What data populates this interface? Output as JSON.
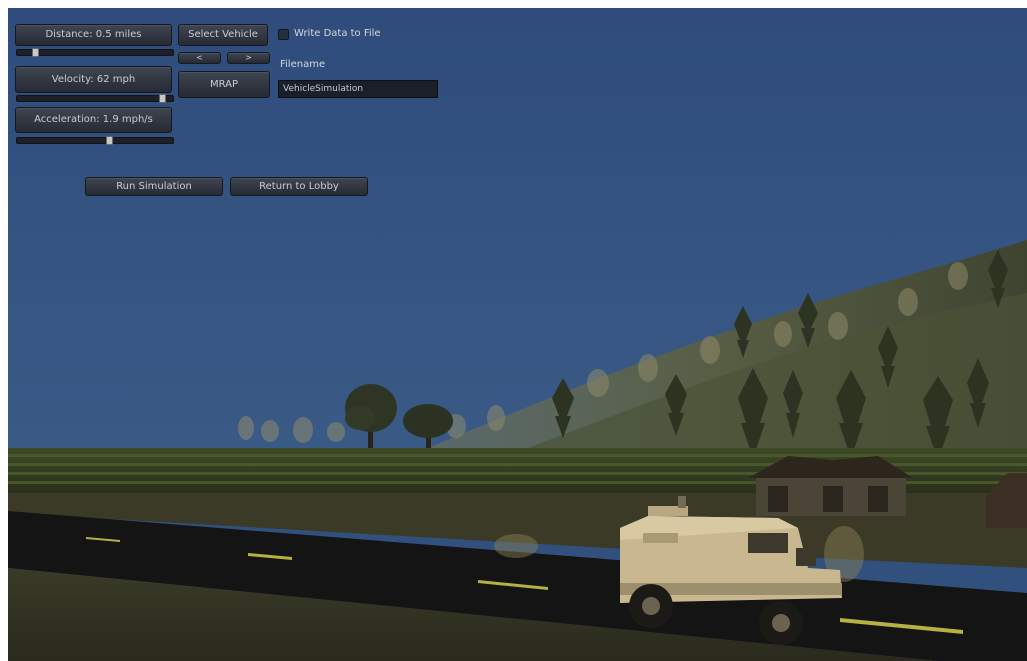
{
  "controls": {
    "distance_label": "Distance: 0.5 miles",
    "distance_slider_level": 0.1,
    "velocity_label": "Velocity: 62 mph",
    "velocity_slider_level": 0.95,
    "acceleration_label": "Acceleration: 1.9 mph/s",
    "acceleration_slider_level": 0.6,
    "select_vehicle_label": "Select Vehicle",
    "prev_label": "<",
    "next_label": ">",
    "vehicle_name": "MRAP",
    "write_data_label": "Write Data to File",
    "write_data_checked": false,
    "filename_label": "Filename",
    "filename_value": "VehicleSimulation",
    "run_simulation_label": "Run Simulation",
    "return_lobby_label": "Return to Lobby"
  },
  "colors": {
    "sky": "#31507e",
    "road": "#141414",
    "vehicle": "#c9b88f"
  }
}
